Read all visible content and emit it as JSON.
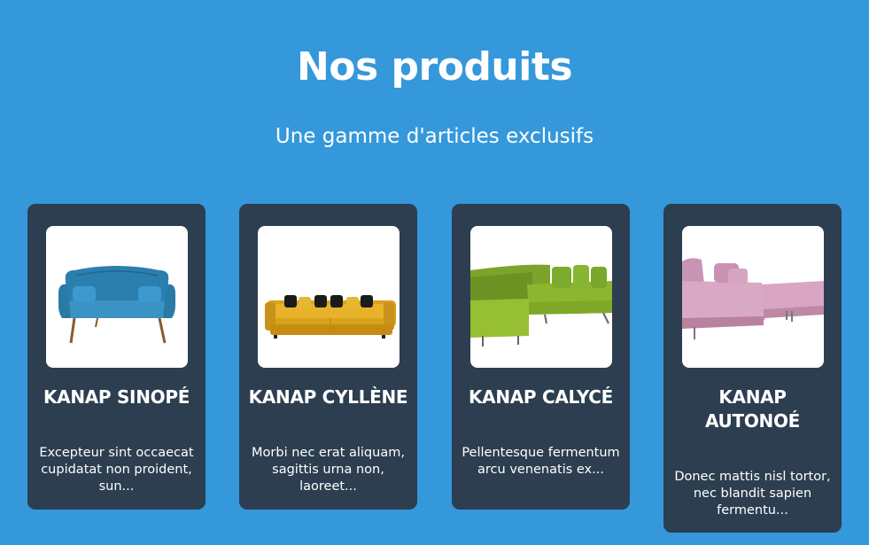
{
  "section": {
    "title": "Nos produits",
    "subtitle": "Une gamme d'articles exclusifs"
  },
  "products": [
    {
      "name": "KANAP SINOPÉ",
      "description": "Excepteur sint occaecat cupidatat non proident, sun..."
    },
    {
      "name": "KANAP CYLLÈNE",
      "description": "Morbi nec erat aliquam, sagittis urna non, laoreet..."
    },
    {
      "name": "KANAP CALYCÉ",
      "description": "Pellentesque fermentum arcu venenatis ex..."
    },
    {
      "name": "KANAP AUTONOÉ",
      "description": "Donec mattis nisl tortor, nec blandit sapien fermentu..."
    }
  ],
  "colors": {
    "background": "#3498db",
    "card": "#2c3e50",
    "text": "#ffffff"
  }
}
